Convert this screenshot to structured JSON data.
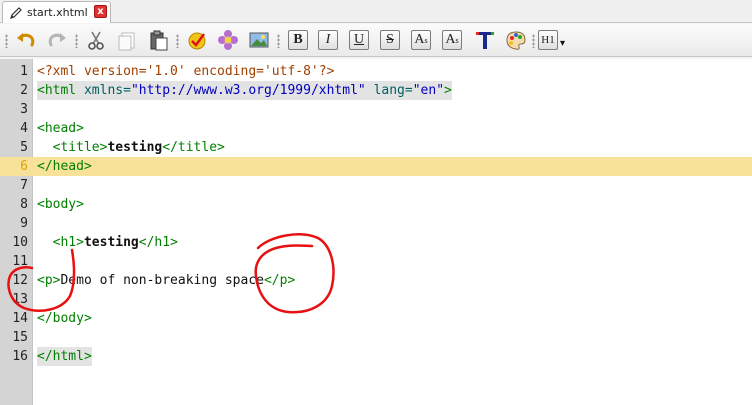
{
  "tab": {
    "label": "start.xhtml",
    "close_label": "x"
  },
  "toolbar": {
    "buttons": [
      {
        "name": "undo-button"
      },
      {
        "name": "redo-button"
      },
      {
        "name": "cut-button"
      },
      {
        "name": "copy-button"
      },
      {
        "name": "paste-button"
      },
      {
        "name": "spellcheck-button"
      },
      {
        "name": "insert-special-char-button"
      },
      {
        "name": "insert-image-button"
      }
    ],
    "format": {
      "bold": "B",
      "italic": "I",
      "underline": "U",
      "strike": "S",
      "subscript_a": "A",
      "subscript_s": "s",
      "superscript_a": "A",
      "superscript_s": "s",
      "heading": "H1",
      "heading_menu": "▾"
    }
  },
  "editor": {
    "current_line": 6,
    "lines": [
      {
        "n": "1",
        "t1": "<?xml version='1.0' encoding='utf-8'?>"
      },
      {
        "n": "2",
        "t1": "<html",
        "t2": " xmlns=",
        "t3": "\"http://www.w3.org/1999/xhtml\"",
        "t4": " lang=",
        "t5": "\"en\"",
        "t6": ">"
      },
      {
        "n": "3"
      },
      {
        "n": "4",
        "t1": "<head>"
      },
      {
        "n": "5",
        "t1": "  <title>",
        "t2": "testing",
        "t3": "</title>"
      },
      {
        "n": "6",
        "t1": "</head>"
      },
      {
        "n": "7"
      },
      {
        "n": "8",
        "t1": "<body>"
      },
      {
        "n": "9"
      },
      {
        "n": "10",
        "t1": "  <h1>",
        "t2": "testing",
        "t3": "</h1>"
      },
      {
        "n": "11"
      },
      {
        "n": "12",
        "t1": "<p>",
        "t2": "Demo of non-breaking space",
        "t3": "</p>"
      },
      {
        "n": "13"
      },
      {
        "n": "14",
        "t1": "</body>"
      },
      {
        "n": "15"
      },
      {
        "n": "16",
        "t1": "</html>"
      }
    ]
  },
  "colors": {
    "current_line": "#f8e29a",
    "annotation": "#e81010",
    "gutter": "#d4d4d4"
  }
}
